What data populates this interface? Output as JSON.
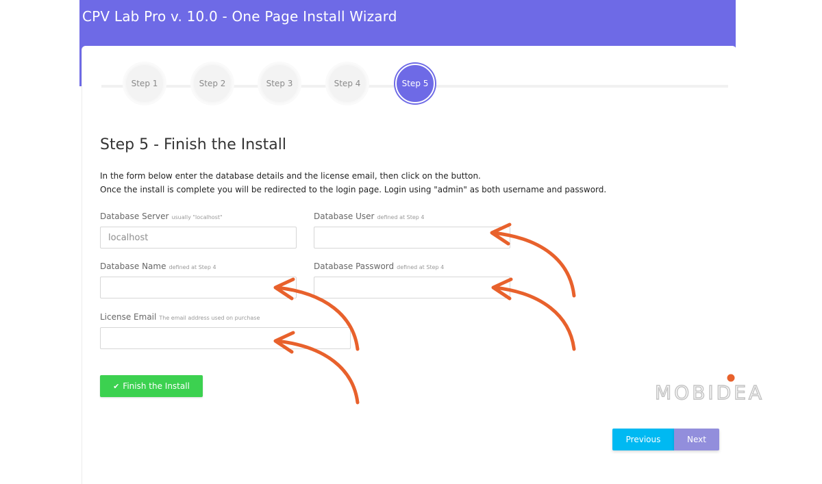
{
  "header": {
    "title": "CPV Lab Pro v. 10.0 - One Page Install Wizard"
  },
  "colors": {
    "accent": "#6e6ae6",
    "finish_button": "#3cd150",
    "previous_button": "#00b9f2",
    "next_button": "#928edc",
    "annotation_arrow": "#e8612c",
    "watermark_dot": "#e8612c"
  },
  "stepper": {
    "steps": [
      {
        "label": "Step 1",
        "active": false
      },
      {
        "label": "Step 2",
        "active": false
      },
      {
        "label": "Step 3",
        "active": false
      },
      {
        "label": "Step 4",
        "active": false
      },
      {
        "label": "Step 5",
        "active": true
      }
    ]
  },
  "page": {
    "title": "Step 5 - Finish the Install",
    "intro_line1": "In the form below enter the database details and the license email, then click on the button.",
    "intro_line2": "Once the install is complete you will be redirected to the login page. Login using \"admin\" as both username and password."
  },
  "form": {
    "db_server": {
      "label": "Database Server",
      "hint": "usually \"localhost\"",
      "value": "",
      "placeholder": "localhost"
    },
    "db_user": {
      "label": "Database User",
      "hint": "defined at Step 4",
      "value": "",
      "placeholder": ""
    },
    "db_name": {
      "label": "Database Name",
      "hint": "defined at Step 4",
      "value": "",
      "placeholder": ""
    },
    "db_password": {
      "label": "Database Password",
      "hint": "defined at Step 4",
      "value": "",
      "placeholder": ""
    },
    "license_email": {
      "label": "License Email",
      "hint": "The email address used on purchase",
      "value": "",
      "placeholder": ""
    },
    "finish_label": "Finish the Install",
    "finish_icon": "check-icon"
  },
  "navigation": {
    "previous_label": "Previous",
    "next_label": "Next"
  },
  "watermark": {
    "brand": "MOBIDEA"
  }
}
